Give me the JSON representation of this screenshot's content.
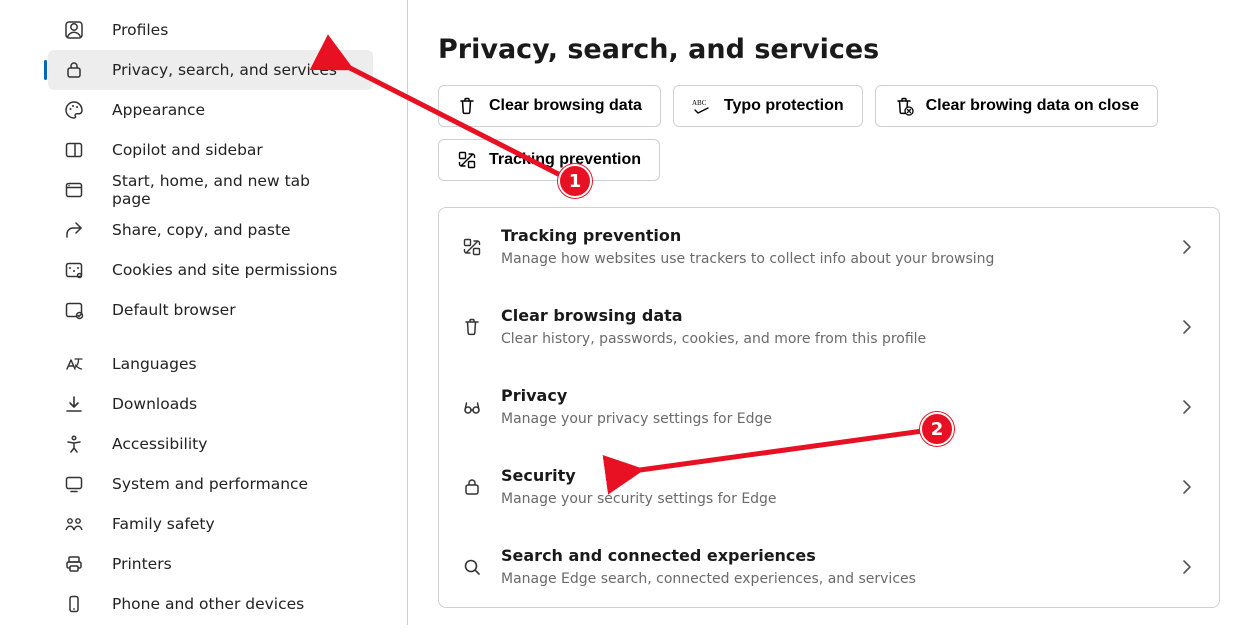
{
  "sidebar": {
    "group1": [
      {
        "label": "Profiles",
        "icon": "profile-icon",
        "selected": false
      },
      {
        "label": "Privacy, search, and services",
        "icon": "lock-icon",
        "selected": true
      },
      {
        "label": "Appearance",
        "icon": "palette-icon",
        "selected": false
      },
      {
        "label": "Copilot and sidebar",
        "icon": "sidebar-icon",
        "selected": false
      },
      {
        "label": "Start, home, and new tab page",
        "icon": "startpage-icon",
        "selected": false
      },
      {
        "label": "Share, copy, and paste",
        "icon": "share-icon",
        "selected": false
      },
      {
        "label": "Cookies and site permissions",
        "icon": "cookies-icon",
        "selected": false
      },
      {
        "label": "Default browser",
        "icon": "default-browser-icon",
        "selected": false
      }
    ],
    "group2": [
      {
        "label": "Languages",
        "icon": "languages-icon"
      },
      {
        "label": "Downloads",
        "icon": "download-icon"
      },
      {
        "label": "Accessibility",
        "icon": "accessibility-icon"
      },
      {
        "label": "System and performance",
        "icon": "system-icon"
      },
      {
        "label": "Family safety",
        "icon": "family-icon"
      },
      {
        "label": "Printers",
        "icon": "printer-icon"
      },
      {
        "label": "Phone and other devices",
        "icon": "phone-icon"
      }
    ]
  },
  "page": {
    "title": "Privacy, search, and services",
    "chips": [
      {
        "label": "Clear browsing data",
        "icon": "trash-icon"
      },
      {
        "label": "Typo protection",
        "icon": "abc-icon"
      },
      {
        "label": "Clear browing data on close",
        "icon": "trash-x-icon"
      },
      {
        "label": "Tracking prevention",
        "icon": "tracking-icon"
      }
    ],
    "rows": [
      {
        "title": "Tracking prevention",
        "desc": "Manage how websites use trackers to collect info about your browsing",
        "icon": "tracking-icon"
      },
      {
        "title": "Clear browsing data",
        "desc": "Clear history, passwords, cookies, and more from this profile",
        "icon": "trash-icon"
      },
      {
        "title": "Privacy",
        "desc": "Manage your privacy settings for Edge",
        "icon": "glasses-icon"
      },
      {
        "title": "Security",
        "desc": "Manage your security settings for Edge",
        "icon": "lock-icon"
      },
      {
        "title": "Search and connected experiences",
        "desc": "Manage Edge search, connected experiences, and services",
        "icon": "search-icon"
      }
    ]
  },
  "annotations": {
    "step1": "1",
    "step2": "2"
  }
}
